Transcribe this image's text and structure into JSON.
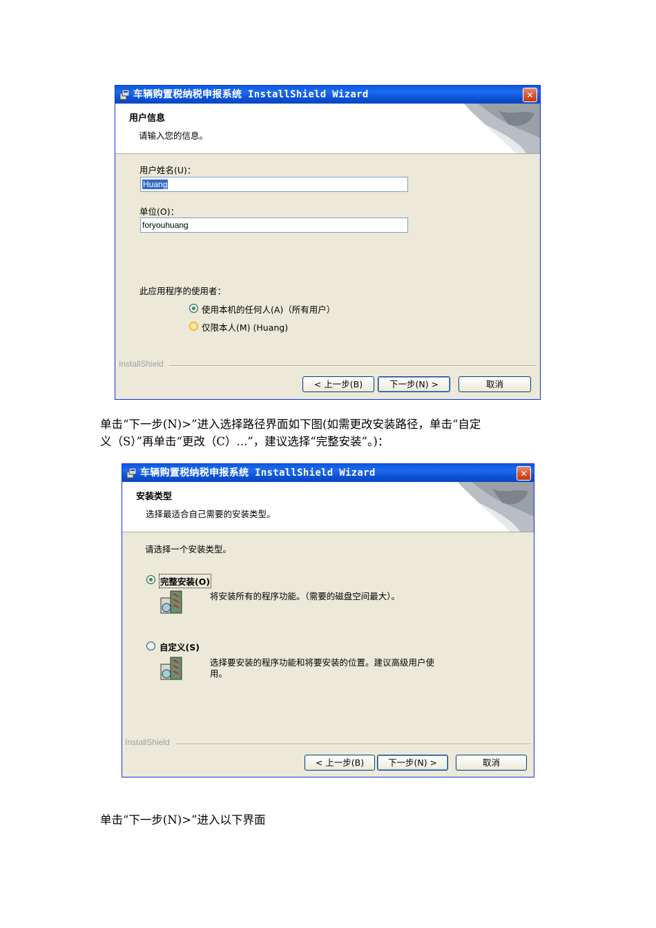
{
  "dialog1": {
    "title": "车辆购置税纳税申报系统 InstallShield Wizard",
    "header_title": "用户信息",
    "header_subtitle": "请输入您的信息。",
    "username_label": "用户姓名(U)：",
    "username_value": "Huang",
    "org_label": "单位(O)：",
    "org_value": "foryouhuang",
    "users_label": "此应用程序的使用者：",
    "radio_all": "使用本机的任何人(A)（所有用户）",
    "radio_me": "仅限本人(M) (Huang)",
    "brand": "InstallShield",
    "back": "< 上一步(B)",
    "next": "下一步(N) >",
    "cancel": "取消"
  },
  "text1_line1": "单击“下一步(N)>”进入选择路径界面如下图(如需更改安装路径，单击“自定",
  "text1_line2": "义（S）”再单击“更改（C）...”，建议选择“完整安装”。)：",
  "dialog2": {
    "title": "车辆购置税纳税申报系统 InstallShield Wizard",
    "header_title": "安装类型",
    "header_subtitle": "选择最适合自己需要的安装类型。",
    "prompt": "请选择一个安装类型。",
    "complete_label": "完整安装(O)",
    "complete_desc": "将安装所有的程序功能。（需要的磁盘空间最大）。",
    "custom_label": "自定义(S)",
    "custom_desc_1": "选择要安装的程序功能和将要安装的位置。建议高级用户使",
    "custom_desc_2": "用。",
    "brand": "InstallShield",
    "back": "< 上一步(B)",
    "next": "下一步(N) >",
    "cancel": "取消"
  },
  "text2": "单击“下一步(N)>”进入以下界面",
  "icons": {
    "title": "installer-icon",
    "close": "close-icon",
    "header": "page-curl-art",
    "package": "package-icon"
  }
}
